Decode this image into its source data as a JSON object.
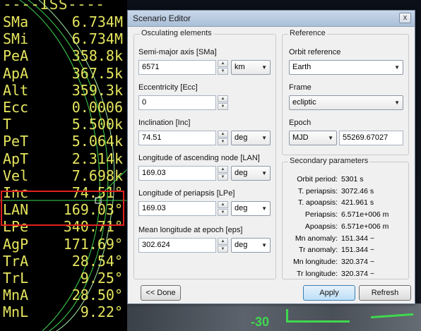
{
  "hud": {
    "title": "----ISS----",
    "rows": [
      {
        "label": "SMa",
        "value": "6.734M"
      },
      {
        "label": "SMi",
        "value": "6.734M"
      },
      {
        "label": "PeA",
        "value": "358.8k"
      },
      {
        "label": "ApA",
        "value": "367.5k"
      },
      {
        "label": "Alt",
        "value": "359.3k"
      },
      {
        "label": "Ecc",
        "value": "0.0006"
      },
      {
        "label": "T",
        "value": "5.500k"
      },
      {
        "label": "PeT",
        "value": "5.064k"
      },
      {
        "label": "ApT",
        "value": "2.314k"
      },
      {
        "label": "Vel",
        "value": "7.698k"
      },
      {
        "label": "Inc",
        "value": "74.51°"
      },
      {
        "label": "LAN",
        "value": "169.03°"
      },
      {
        "label": "LPe",
        "value": "340.71°"
      },
      {
        "label": "AgP",
        "value": "171.69°"
      },
      {
        "label": "TrA",
        "value": "28.54°"
      },
      {
        "label": "TrL",
        "value": "9.25°"
      },
      {
        "label": "MnA",
        "value": "28.50°"
      },
      {
        "label": "MnL",
        "value": "9.22°"
      }
    ],
    "highlight_color": "#e12020",
    "text_color": "#e5e55e"
  },
  "scene": {
    "pitch_readout": "-30",
    "hud_color": "#3fd84f"
  },
  "window": {
    "title": "Scenario Editor",
    "close_glyph": "x",
    "osculating": {
      "legend": "Osculating elements",
      "sma_label": "Semi-major axis [SMa]",
      "sma_value": "6571",
      "sma_unit": "km",
      "ecc_label": "Eccentricity [Ecc]",
      "ecc_value": "0",
      "inc_label": "Inclination [Inc]",
      "inc_value": "74.51",
      "inc_unit": "deg",
      "lan_label": "Longitude of ascending node [LAN]",
      "lan_value": "169.03",
      "lan_unit": "deg",
      "lpe_label": "Longitude of periapsis [LPe]",
      "lpe_value": "169.03",
      "lpe_unit": "deg",
      "eps_label": "Mean longitude at epoch [eps]",
      "eps_value": "302.624",
      "eps_unit": "deg"
    },
    "reference": {
      "legend": "Reference",
      "orbit_ref_label": "Orbit reference",
      "orbit_ref_value": "Earth",
      "frame_label": "Frame",
      "frame_value": "ecliptic",
      "epoch_label": "Epoch",
      "epoch_format": "MJD",
      "epoch_value": "55269.67027"
    },
    "secondary": {
      "legend": "Secondary parameters",
      "rows": [
        {
          "k": "Orbit period:",
          "v": "5301 s"
        },
        {
          "k": "T. periapsis:",
          "v": "3072.46 s"
        },
        {
          "k": "T. apoapsis:",
          "v": "421.961 s"
        },
        {
          "k": "Periapsis:",
          "v": "6.571e+006 m"
        },
        {
          "k": "Apoapsis:",
          "v": "6.571e+006 m"
        },
        {
          "k": "Mn anomaly:",
          "v": "151.344 ~"
        },
        {
          "k": "Tr anomaly:",
          "v": "151.344 ~"
        },
        {
          "k": "Mn longitude:",
          "v": "320.374 ~"
        },
        {
          "k": "Tr longitude:",
          "v": "320.374 ~"
        }
      ]
    },
    "buttons": {
      "done": "<< Done",
      "apply": "Apply",
      "refresh": "Refresh"
    },
    "spin_up": "▲",
    "spin_down": "▼",
    "dropdown_arrow": "▼"
  }
}
